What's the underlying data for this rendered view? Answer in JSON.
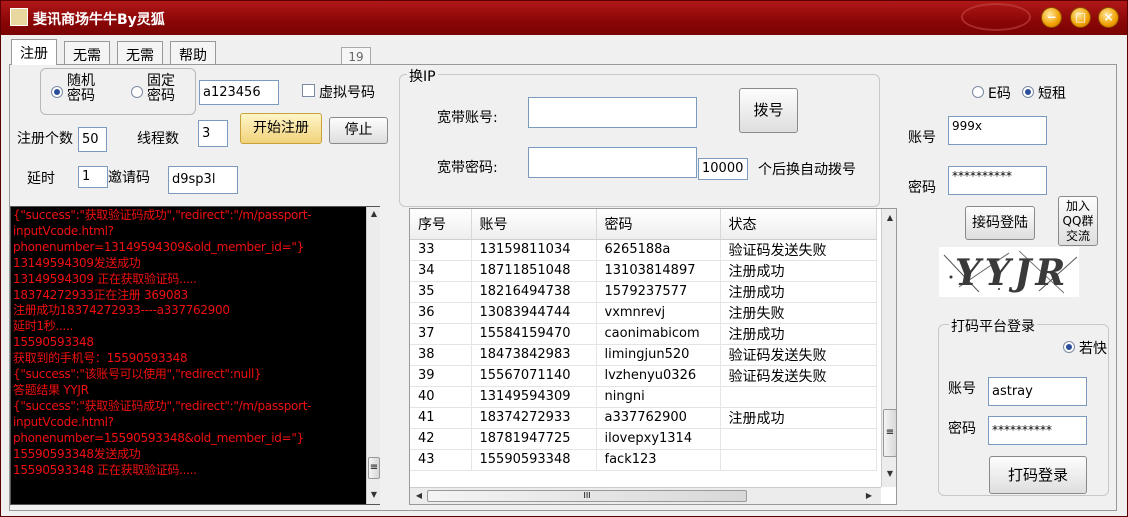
{
  "window": {
    "title": "斐讯商场牛牛By灵狐",
    "icon": "app-icon",
    "controls": {
      "minimize": "−",
      "maximize": "□",
      "close": "×"
    }
  },
  "tabs": [
    {
      "label": "注册",
      "active": true
    },
    {
      "label": "无需",
      "active": false
    },
    {
      "label": "无需",
      "active": false
    },
    {
      "label": "帮助",
      "active": false
    }
  ],
  "counter": "19",
  "register": {
    "random_pwd_label": [
      "随机",
      "密码"
    ],
    "fixed_pwd_label": [
      "固定",
      "密码"
    ],
    "password_value": "a123456",
    "virtual_number_label": "虚拟号码",
    "count_label": "注册个数",
    "count_value": "50",
    "threads_label": "线程数",
    "threads_value": "3",
    "start_button": "开始注册",
    "stop_button": "停止",
    "delay_label": "延时",
    "delay_value": "1",
    "invite_label": "邀请码",
    "invite_value": "d9sp3l"
  },
  "ip": {
    "group_label": "换IP",
    "account_label": "宽带账号:",
    "account_value": "",
    "password_label": "宽带密码:",
    "password_value": "",
    "dial_button": "拨号",
    "auto_count_value": "10000",
    "auto_label": "个后换自动拨号"
  },
  "log_lines": [
    "{\"success\":\"获取验证码成功\",\"redirect\":\"/m/passport-",
    "inputVcode.html?",
    "phonenumber=13149594309&old_member_id=\"}",
    "13149594309发送成功",
    "13149594309 正在获取验证码.....",
    "18374272933正在注册  369083",
    "注册成功18374272933----a337762900",
    "延时1秒.....",
    "15590593348",
    "获取到的手机号：15590593348",
    "{\"success\":\"该账号可以使用\",\"redirect\":null}",
    "答题结果      YYJR",
    "{\"success\":\"获取验证码成功\",\"redirect\":\"/m/passport-",
    "inputVcode.html?",
    "phonenumber=15590593348&old_member_id=\"}",
    "15590593348发送成功",
    "15590593348 正在获取验证码....."
  ],
  "table": {
    "columns": [
      "序号",
      "账号",
      "密码",
      "状态"
    ],
    "rows": [
      [
        "33",
        "13159811034",
        "6265188a",
        "验证码发送失败"
      ],
      [
        "34",
        "18711851048",
        "13103814897",
        "注册成功"
      ],
      [
        "35",
        "18216494738",
        "1579237577",
        "注册成功"
      ],
      [
        "36",
        "13083944744",
        "vxmnrevj",
        "注册失败"
      ],
      [
        "37",
        "15584159470",
        "caonimabicom",
        "注册成功"
      ],
      [
        "38",
        "18473842983",
        "limingjun520",
        "验证码发送失败"
      ],
      [
        "39",
        "15567071140",
        "lvzhenyu0326",
        "验证码发送失败"
      ],
      [
        "40",
        "13149594309",
        "ningni",
        ""
      ],
      [
        "41",
        "18374272933",
        "a337762900",
        "注册成功"
      ],
      [
        "42",
        "18781947725",
        "ilovepxy1314",
        ""
      ],
      [
        "43",
        "15590593348",
        "fack123",
        ""
      ]
    ]
  },
  "sms": {
    "e_code_label": "E码",
    "short_rent_label": "短租",
    "account_label": "账号",
    "account_value": "999x",
    "password_label": "密码",
    "password_value": "**********",
    "login_button": "接码登陆",
    "qq_button": [
      "加入",
      "QQ群",
      "交流"
    ],
    "captcha_text": "YYJR"
  },
  "captcha_platform": {
    "group_label": "打码平台登录",
    "ruokuai_label": "若快",
    "account_label": "账号",
    "account_value": "astray",
    "password_label": "密码",
    "password_value": "**********",
    "login_button": "打码登录"
  },
  "scroll": {
    "up": "▲",
    "down": "▼",
    "left": "◀",
    "right": "▶",
    "grip": "≡",
    "hgrip": "III"
  }
}
